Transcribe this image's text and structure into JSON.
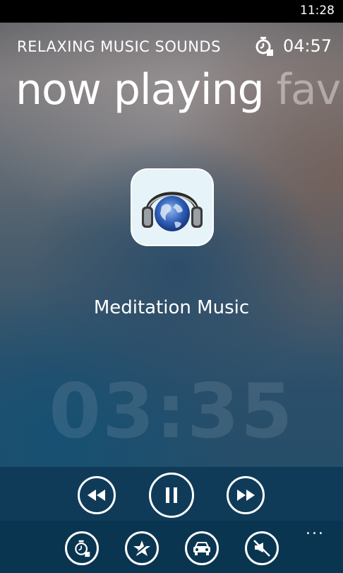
{
  "status_bar": {
    "time": "11:28"
  },
  "header": {
    "app_title": "RELAXING MUSIC SOUNDS",
    "sleep_timer": "04:57"
  },
  "pivot": {
    "current": "now playing",
    "next": "fav"
  },
  "player": {
    "track_title": "Meditation Music",
    "elapsed_clock": "03:35"
  },
  "controls": {
    "rewind": "rewind-icon",
    "pause": "pause-icon",
    "fast_forward": "fast-forward-icon"
  },
  "app_bar": {
    "buttons": [
      "sleep-timer-icon",
      "favorite-icon",
      "car-mode-icon",
      "no-ads-icon"
    ],
    "more": "..."
  },
  "colors": {
    "controls_bar": "#0f3b58",
    "app_bar": "#0a3550"
  }
}
